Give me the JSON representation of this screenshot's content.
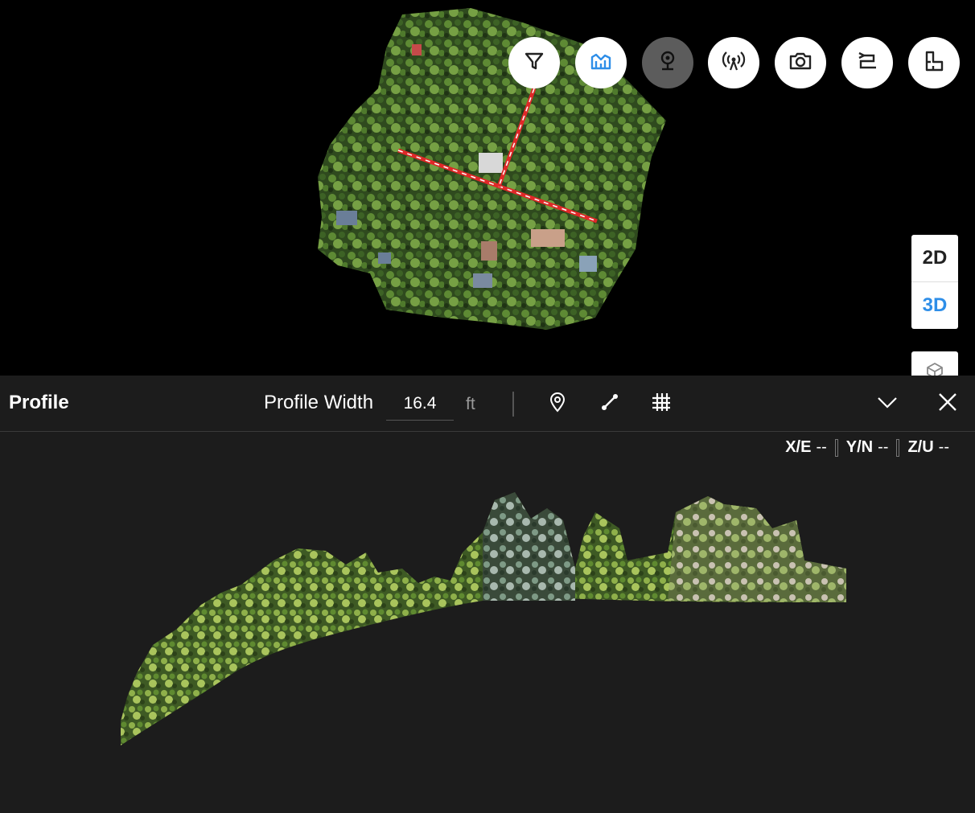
{
  "toolbar": {
    "buttons": [
      {
        "icon": "filter-icon",
        "state": "default"
      },
      {
        "icon": "profile-chart-icon",
        "state": "highlighted"
      },
      {
        "icon": "location-pin-icon",
        "state": "active"
      },
      {
        "icon": "broadcast-icon",
        "state": "default"
      },
      {
        "icon": "camera-icon",
        "state": "default"
      },
      {
        "icon": "route-icon",
        "state": "default"
      },
      {
        "icon": "floor-plan-icon",
        "state": "default"
      }
    ]
  },
  "view_mode": {
    "options": [
      "2D",
      "3D"
    ],
    "selected": "3D"
  },
  "profile": {
    "title": "Profile",
    "width_label": "Profile Width",
    "width_value": "16.4",
    "width_unit": "ft",
    "coords": {
      "x_label": "X/E",
      "x_value": "--",
      "y_label": "Y/N",
      "y_value": "--",
      "z_label": "Z/U",
      "z_value": "--"
    }
  },
  "colors": {
    "accent": "#2e8ee8",
    "panel_bg": "#1c1c1c",
    "profile_line": "#e02828"
  }
}
